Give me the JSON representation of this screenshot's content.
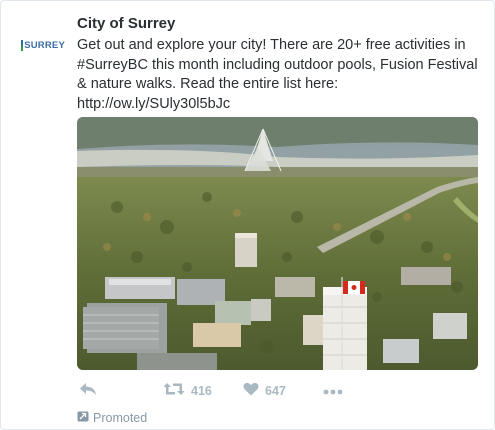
{
  "account": {
    "name": "City of Surrey",
    "avatar_wordmark": "SURREY"
  },
  "tweet": {
    "text": "Get out and explore your city! There are 20+ free activities in #SurreyBC this month including outdoor pools, Fusion Festival & nature walks. Read the entire list here: http://ow.ly/SUly30l5bJc",
    "retweets": "416",
    "likes": "647"
  },
  "icons": {
    "reply": "reply-icon",
    "retweet": "retweet-icon",
    "like": "heart-icon",
    "more": "more-icon",
    "promoted": "promoted-icon"
  },
  "promoted_label": "Promoted",
  "colors": {
    "text": "#292f33",
    "action_gray": "#aab8c2",
    "promoted_gray": "#8899a6",
    "border": "#e1e8ed"
  }
}
